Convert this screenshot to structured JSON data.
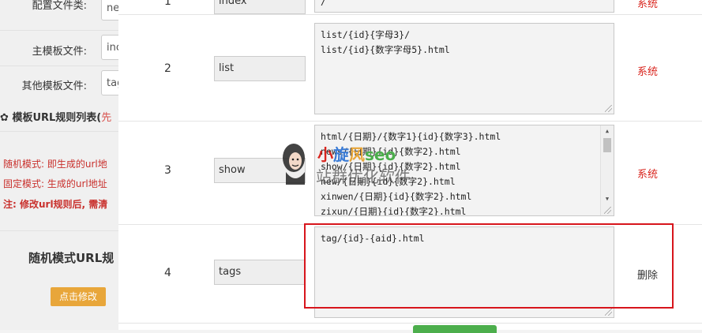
{
  "background_page": {
    "config_rows": [
      {
        "label": "配置文件类:",
        "value": "ne"
      },
      {
        "label": "主模板文件:",
        "value": "inc"
      },
      {
        "label": "其他模板文件:",
        "value": "tag"
      }
    ],
    "section_title": "模板URL规则列表(",
    "section_note": "先",
    "notes": [
      "随机模式: 即生成的url地",
      "固定模式: 生成的url地址",
      "注: 修改url规则后, 需清"
    ],
    "mode_title": "随机模式URL规",
    "edit_button": "点击修改"
  },
  "rules": [
    {
      "num": "1",
      "name": "index",
      "lines": [
        "/"
      ],
      "action": "系统",
      "action_type": "system"
    },
    {
      "num": "2",
      "name": "list",
      "lines": [
        "list/{id}{字母3}/",
        "list/{id}{数字字母5}.html"
      ],
      "action": "系统",
      "action_type": "system"
    },
    {
      "num": "3",
      "name": "show",
      "lines": [
        "html/{日期}/{数字1}{id}{数字3}.html",
        "news/{日期}{id}{数字2}.html",
        "show/{日期}{id}{数字2}.html",
        "new/{日期}{id}{数字2}.html",
        "xinwen/{日期}{id}{数字2}.html",
        "zixun/{日期}{id}{数字2}.html"
      ],
      "action": "系统",
      "action_type": "system"
    },
    {
      "num": "4",
      "name": "tags",
      "lines": [
        "tag/{id}-{aid}.html"
      ],
      "action": "删除",
      "action_type": "delete"
    }
  ],
  "watermark": {
    "brand": "小旋风seo",
    "text": "站群优化软件"
  },
  "colors": {
    "system_action": "#d9251e",
    "highlight_border": "#d7151c",
    "edit_button": "#e8a63a"
  }
}
